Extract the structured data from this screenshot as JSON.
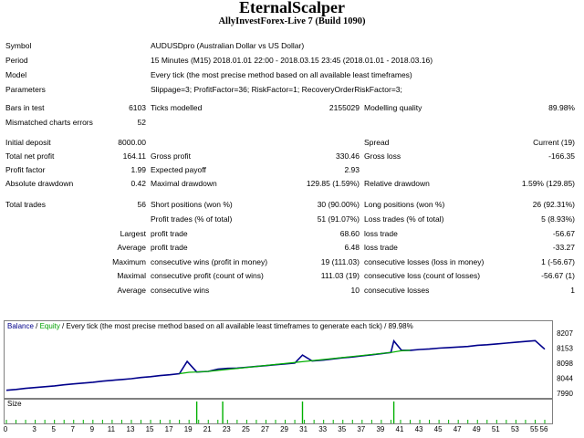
{
  "header": {
    "title": "EternalScalper",
    "subtitle": "AllyInvestForex-Live 7 (Build 1090)"
  },
  "info": {
    "symbol_label": "Symbol",
    "symbol_value": "AUDUSDpro (Australian Dollar vs US Dollar)",
    "period_label": "Period",
    "period_value": "15 Minutes (M15) 2018.01.01 22:00 - 2018.03.15 23:45 (2018.01.01 - 2018.03.16)",
    "model_label": "Model",
    "model_value": "Every tick (the most precise method based on all available least timeframes)",
    "params_label": "Parameters",
    "params_value": "Slippage=3; ProfitFactor=36; RiskFactor=1; RecoveryOrderRiskFactor=3;"
  },
  "stats": {
    "bars_label": "Bars in test",
    "bars_value": "6103",
    "ticks_label": "Ticks modelled",
    "ticks_value": "2155029",
    "quality_label": "Modelling quality",
    "quality_value": "89.98%",
    "mismatch_label": "Mismatched charts errors",
    "mismatch_value": "52",
    "deposit_label": "Initial deposit",
    "deposit_value": "8000.00",
    "spread_label": "Spread",
    "spread_value": "Current (19)",
    "netprofit_label": "Total net profit",
    "netprofit_value": "164.11",
    "grossprofit_label": "Gross profit",
    "grossprofit_value": "330.46",
    "grossloss_label": "Gross loss",
    "grossloss_value": "-166.35",
    "pf_label": "Profit factor",
    "pf_value": "1.99",
    "payoff_label": "Expected payoff",
    "payoff_value": "2.93",
    "absdd_label": "Absolute drawdown",
    "absdd_value": "0.42",
    "maxdd_label": "Maximal drawdown",
    "maxdd_value": "129.85 (1.59%)",
    "reldd_label": "Relative drawdown",
    "reldd_value": "1.59% (129.85)",
    "trades_label": "Total trades",
    "trades_value": "56",
    "short_label": "Short positions (won %)",
    "short_value": "30 (90.00%)",
    "long_label": "Long positions (won %)",
    "long_value": "26 (92.31%)",
    "profittrades_label": "Profit trades (% of total)",
    "profittrades_value": "51 (91.07%)",
    "losstrades_label": "Loss trades (% of total)",
    "losstrades_value": "5 (8.93%)",
    "largest_label": "Largest",
    "largest_profit_label": "profit trade",
    "largest_profit_value": "68.60",
    "largest_loss_label": "loss trade",
    "largest_loss_value": "-56.67",
    "average_label": "Average",
    "average_profit_label": "profit trade",
    "average_profit_value": "6.48",
    "average_loss_label": "loss trade",
    "average_loss_value": "-33.27",
    "maximum_label": "Maximum",
    "max_wins_label": "consecutive wins (profit in money)",
    "max_wins_value": "19 (111.03)",
    "max_losses_label": "consecutive losses (loss in money)",
    "max_losses_value": "1 (-56.67)",
    "maximal_label": "Maximal",
    "maximal_profit_label": "consecutive profit (count of wins)",
    "maximal_profit_value": "111.03 (19)",
    "maximal_loss_label": "consecutive loss (count of losses)",
    "maximal_loss_value": "-56.67 (1)",
    "avgc_label": "Average",
    "avg_wins_label": "consecutive wins",
    "avg_wins_value": "10",
    "avg_losses_label": "consecutive losses",
    "avg_losses_value": "1"
  },
  "chart": {
    "legend_balance": "Balance",
    "legend_sep": " / ",
    "legend_equity": "Equity",
    "legend_rest": " / Every tick (the most precise method based on all available least timeframes to generate each tick) / 89.98%",
    "size_label": "Size",
    "balance_color": "#00008b",
    "equity_color": "#00b000",
    "size_bar_color": "#00b000"
  },
  "chart_data": {
    "type": "line",
    "y_ticks": [
      "8207",
      "8153",
      "8098",
      "8044",
      "7990"
    ],
    "x_ticks": [
      "0",
      "3",
      "5",
      "7",
      "9",
      "11",
      "13",
      "15",
      "17",
      "19",
      "21",
      "23",
      "25",
      "27",
      "29",
      "31",
      "33",
      "35",
      "37",
      "39",
      "41",
      "43",
      "45",
      "47",
      "49",
      "51",
      "53",
      "55",
      "56"
    ],
    "xlim": [
      0,
      56
    ],
    "ylim": [
      7990,
      8220
    ],
    "series": [
      {
        "name": "Balance",
        "x": [
          0,
          1,
          2,
          3,
          4,
          5,
          6,
          7,
          8,
          9,
          10,
          11,
          12,
          13,
          14,
          15,
          16,
          17,
          18,
          18.8,
          19.8,
          21,
          22,
          23,
          24,
          25,
          26,
          27,
          28,
          29,
          30,
          30.8,
          31.8,
          33,
          34,
          35,
          36,
          37,
          38,
          39,
          40,
          40.3,
          41.1,
          42,
          43,
          44,
          45,
          46,
          47,
          48,
          49,
          50,
          51,
          52,
          53,
          54,
          55,
          56
        ],
        "y": [
          8004,
          8007,
          8011,
          8014,
          8017,
          8020,
          8024,
          8027,
          8030,
          8033,
          8037,
          8040,
          8043,
          8046,
          8050,
          8053,
          8057,
          8060,
          8064,
          8108,
          8070,
          8072,
          8080,
          8083,
          8084,
          8087,
          8090,
          8093,
          8096,
          8099,
          8102,
          8131,
          8110,
          8113,
          8117,
          8121,
          8124,
          8128,
          8132,
          8136,
          8140,
          8182,
          8148,
          8148,
          8151,
          8153,
          8156,
          8158,
          8160,
          8162,
          8166,
          8168,
          8171,
          8174,
          8177,
          8180,
          8183,
          8152
        ]
      },
      {
        "name": "Equity",
        "x": [
          18,
          19,
          19.8,
          21,
          40,
          41,
          42
        ],
        "y": [
          8064,
          8069,
          8070,
          8072,
          8140,
          8146,
          8148
        ]
      }
    ],
    "size_bars_x": [
      19.8,
      22.5,
      30.8,
      40.3
    ]
  }
}
